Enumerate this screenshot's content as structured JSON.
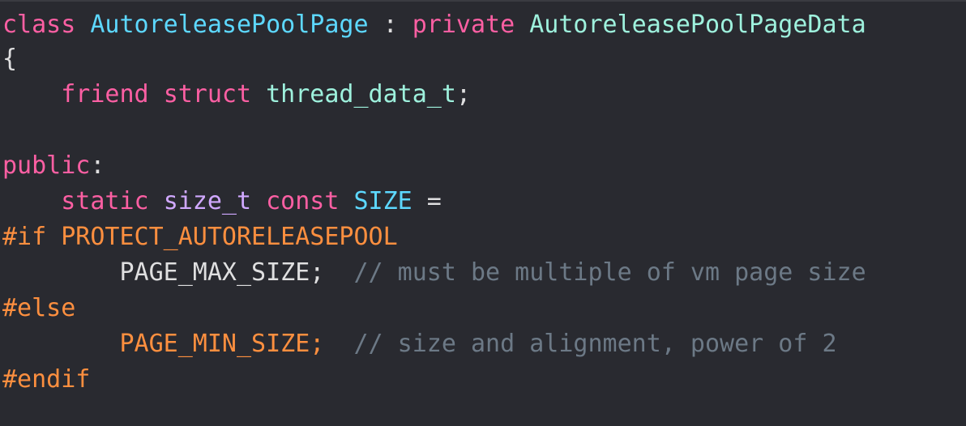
{
  "code": {
    "line1": {
      "class_kw": "class",
      "class_name": "AutoreleasePoolPage",
      "colon": " : ",
      "private_kw": "private",
      "base_name": "AutoreleasePoolPageData"
    },
    "line2": {
      "brace": "{"
    },
    "line3": {
      "indent": "    ",
      "friend_kw": "friend",
      "struct_kw": "struct",
      "type_name": "thread_data_t",
      "semicolon": ";"
    },
    "line5": {
      "public_kw": "public",
      "colon": ":"
    },
    "line6": {
      "indent": "    ",
      "static_kw": "static",
      "size_type": "size_t",
      "const_kw": "const",
      "size_name": "SIZE",
      "equals": " ="
    },
    "line7": {
      "directive": "#if PROTECT_AUTORELEASEPOOL"
    },
    "line8": {
      "indent": "        ",
      "value": "PAGE_MAX_SIZE;",
      "gap": "  ",
      "comment": "// must be multiple of vm page size"
    },
    "line9": {
      "directive": "#else"
    },
    "line10": {
      "indent": "        ",
      "value": "PAGE_MIN_SIZE;",
      "gap": "  ",
      "comment": "// size and alignment, power of 2"
    },
    "line11": {
      "directive": "#endif"
    }
  },
  "colors": {
    "background": "#292a30",
    "keyword": "#fc5fa3",
    "type": "#d0a8ff",
    "identifier": "#5dd8ff",
    "type_name": "#9ef1dd",
    "preprocessor": "#fd8f3f",
    "plain": "#dfdfe0",
    "comment": "#6c7986"
  }
}
